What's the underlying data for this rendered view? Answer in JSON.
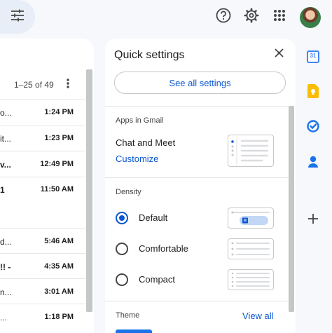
{
  "header": {
    "filter_icon": "tune-icon",
    "help_icon": "help-circle-icon",
    "settings_icon": "gear-icon",
    "apps_icon": "apps-grid-icon",
    "avatar": "user-avatar"
  },
  "mail": {
    "range": "1–25 of 49",
    "rows": [
      {
        "sender": "o...",
        "time": "1:24 PM",
        "bold": false
      },
      {
        "sender": "it...",
        "time": "1:23 PM",
        "bold": false
      },
      {
        "sender": "v...",
        "time": "12:49 PM",
        "bold": true
      },
      {
        "sender": "1",
        "time": "11:50 AM",
        "bold": true
      },
      {
        "sender": "d...",
        "time": "5:46 AM",
        "bold": false
      },
      {
        "sender": "!! -",
        "time": "4:35 AM",
        "bold": true
      },
      {
        "sender": "n...",
        "time": "3:01 AM",
        "bold": false
      },
      {
        "sender": "...",
        "time": "1:18 PM",
        "bold": false
      }
    ]
  },
  "quick_settings": {
    "title": "Quick settings",
    "see_all": "See all settings",
    "apps_section": "Apps in Gmail",
    "chat_meet": "Chat and Meet",
    "customize": "Customize",
    "density_section": "Density",
    "density_options": [
      {
        "label": "Default",
        "selected": true
      },
      {
        "label": "Comfortable",
        "selected": false
      },
      {
        "label": "Compact",
        "selected": false
      }
    ],
    "theme_section": "Theme",
    "view_all": "View all"
  },
  "side_panel": {
    "calendar_label": "31",
    "icons": [
      "calendar-icon",
      "keep-icon",
      "tasks-icon",
      "contacts-icon",
      "add-icon"
    ]
  },
  "colors": {
    "accent": "#0b57d0",
    "background": "#f6f8fc",
    "calendar_blue": "#4285f4",
    "keep_yellow": "#fbbc04"
  }
}
